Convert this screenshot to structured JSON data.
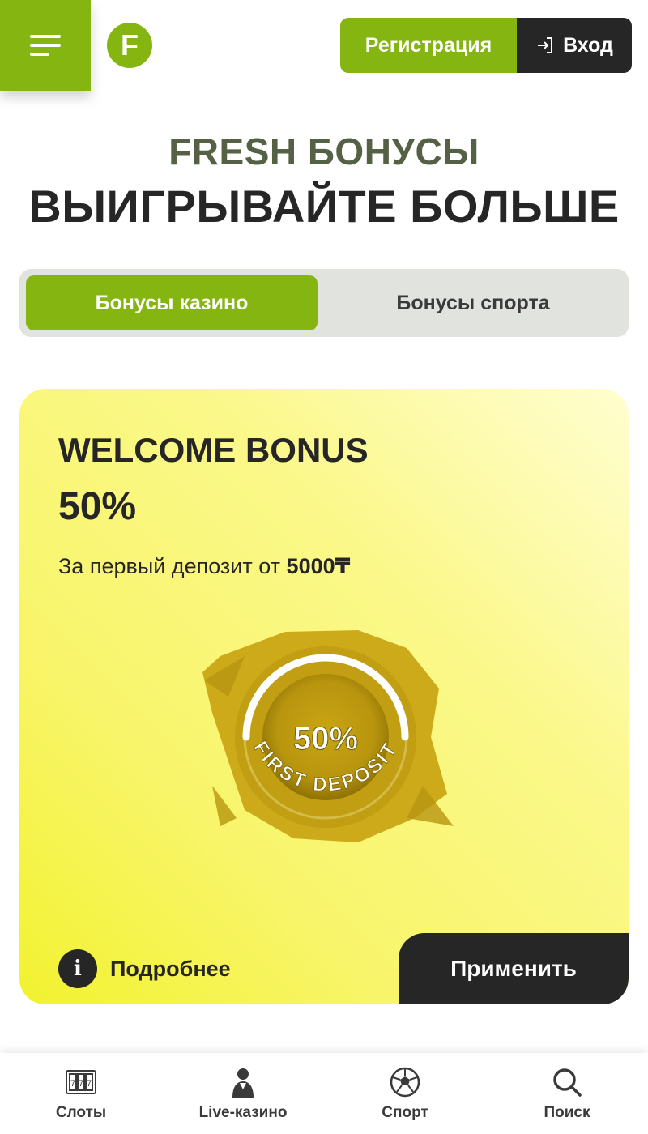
{
  "header": {
    "logo_letter": "F",
    "register_label": "Регистрация",
    "login_label": "Вход"
  },
  "hero": {
    "title_line1": "FRESH БОНУСЫ",
    "title_line2": "ВЫИГРЫВАЙТЕ БОЛЬШЕ"
  },
  "tabs": [
    {
      "label": "Бонусы казино",
      "active": true
    },
    {
      "label": "Бонусы спорта",
      "active": false
    }
  ],
  "bonus_card": {
    "title": "WELCOME BONUS",
    "percent": "50%",
    "description_prefix": "За первый депозит от ",
    "description_amount": "5000₸",
    "badge_value": "50%",
    "badge_caption": "FIRST DEPOSIT",
    "details_label": "Подробнее",
    "info_glyph": "i",
    "apply_label": "Применить"
  },
  "bottom_nav": [
    {
      "label": "Слоты",
      "icon": "slots-icon"
    },
    {
      "label": "Live-казино",
      "icon": "live-dealer-icon"
    },
    {
      "label": "Спорт",
      "icon": "soccer-ball-icon"
    },
    {
      "label": "Поиск",
      "icon": "search-icon"
    }
  ],
  "colors": {
    "brand_green": "#84b511",
    "dark": "#262626",
    "title_olive": "#556144",
    "tabs_bg": "#e1e3df",
    "gold": "#c9a514"
  }
}
